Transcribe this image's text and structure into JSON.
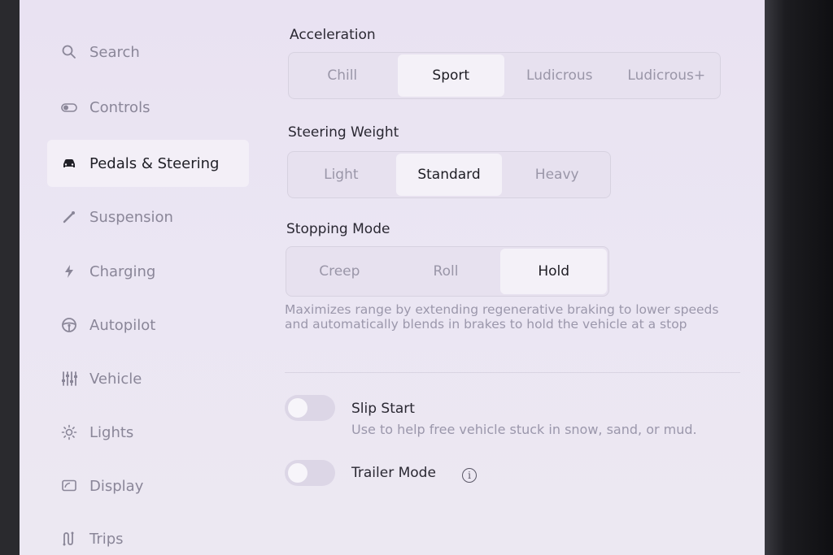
{
  "sidebar": {
    "items": [
      {
        "label": "Search",
        "icon": "search-icon"
      },
      {
        "label": "Controls",
        "icon": "toggle-icon"
      },
      {
        "label": "Pedals & Steering",
        "icon": "car-icon",
        "active": true
      },
      {
        "label": "Suspension",
        "icon": "wrench-icon"
      },
      {
        "label": "Charging",
        "icon": "lightning-icon"
      },
      {
        "label": "Autopilot",
        "icon": "steering-wheel-icon"
      },
      {
        "label": "Vehicle",
        "icon": "sliders-icon"
      },
      {
        "label": "Lights",
        "icon": "sun-icon"
      },
      {
        "label": "Display",
        "icon": "display-icon"
      },
      {
        "label": "Trips",
        "icon": "trips-icon"
      }
    ]
  },
  "acceleration": {
    "title": "Acceleration",
    "options": [
      "Chill",
      "Sport",
      "Ludicrous",
      "Ludicrous+"
    ],
    "selected": "Sport"
  },
  "steering_weight": {
    "title": "Steering Weight",
    "options": [
      "Light",
      "Standard",
      "Heavy"
    ],
    "selected": "Standard"
  },
  "stopping_mode": {
    "title": "Stopping Mode",
    "options": [
      "Creep",
      "Roll",
      "Hold"
    ],
    "selected": "Hold",
    "description": "Maximizes range by extending regenerative braking to lower speeds and automatically blends in brakes to hold the vehicle at a stop"
  },
  "slip_start": {
    "title": "Slip Start",
    "subtitle": "Use to help free vehicle stuck in snow, sand, or mud.",
    "enabled": false
  },
  "trailer_mode": {
    "title": "Trailer Mode",
    "info": "i",
    "enabled": false
  },
  "colors": {
    "screen_bg": "#ebe6f3",
    "active_text": "#1f1f26",
    "inactive_text": "#8a8698"
  }
}
